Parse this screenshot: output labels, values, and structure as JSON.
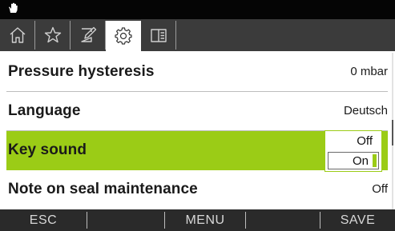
{
  "status_bar": {
    "icon": "hand-icon"
  },
  "tabs": [
    {
      "icon": "home-icon",
      "active": false
    },
    {
      "icon": "star-icon",
      "active": false
    },
    {
      "icon": "edit-icon",
      "active": false
    },
    {
      "icon": "gear-icon",
      "active": true
    },
    {
      "icon": "manual-icon",
      "active": false
    }
  ],
  "settings": [
    {
      "label": "Pressure hysteresis",
      "value": "0 mbar"
    },
    {
      "label": "Language",
      "value": "Deutsch"
    },
    {
      "label": "Key sound",
      "value": ""
    },
    {
      "label": "Note on seal maintenance",
      "value": "Off"
    }
  ],
  "dropdown": {
    "options": [
      "Off",
      "On"
    ],
    "highlighted": "On"
  },
  "softkeys": {
    "esc": "ESC",
    "menu": "MENU",
    "save": "SAVE"
  },
  "colors": {
    "accent": "#9bcc16",
    "tab_bar": "#3b3b3b",
    "status_bar": "#050505",
    "softkey_bar": "#2a2a2a"
  }
}
